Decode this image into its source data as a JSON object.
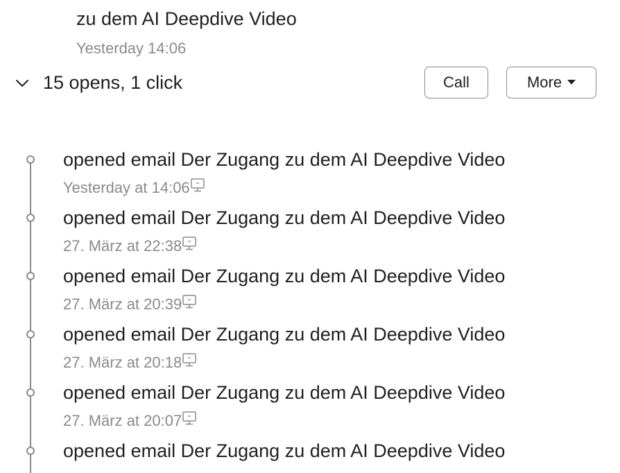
{
  "email": {
    "subject": "zu dem AI Deepdive Video",
    "time": "Yesterday 14:06"
  },
  "summary": {
    "text": "15 opens, 1 click",
    "expanded": true
  },
  "actions": {
    "call_label": "Call",
    "more_label": "More"
  },
  "timeline": {
    "events": [
      {
        "title": "opened email Der Zugang zu dem AI Deepdive Video",
        "time": "Yesterday at 14:06",
        "device_icon": "desktop-icon"
      },
      {
        "title": "opened email Der Zugang zu dem AI Deepdive Video",
        "time": "27. März at 22:38",
        "device_icon": "desktop-icon"
      },
      {
        "title": "opened email Der Zugang zu dem AI Deepdive Video",
        "time": "27. März at 20:39",
        "device_icon": "desktop-icon"
      },
      {
        "title": "opened email Der Zugang zu dem AI Deepdive Video",
        "time": "27. März at 20:18",
        "device_icon": "desktop-icon"
      },
      {
        "title": "opened email Der Zugang zu dem AI Deepdive Video",
        "time": "27. März at 20:07",
        "device_icon": "desktop-icon"
      },
      {
        "title": "opened email Der Zugang zu dem AI Deepdive Video"
      }
    ]
  },
  "colors": {
    "text": "#1f1f1f",
    "muted": "#8a8a8a",
    "border": "#8c8c8c",
    "background": "#ffffff"
  }
}
